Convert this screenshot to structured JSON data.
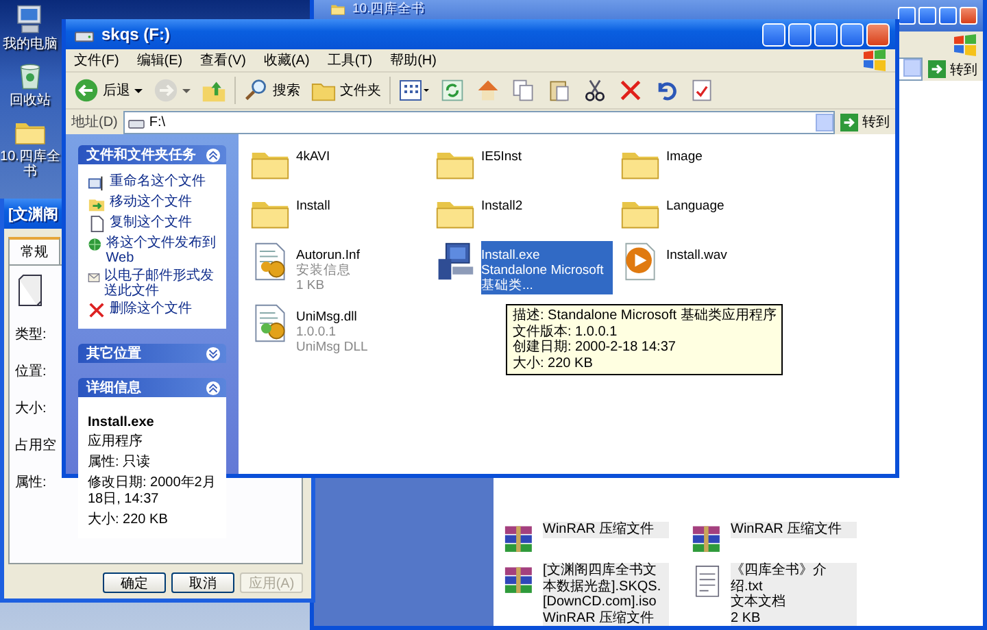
{
  "desktop": {
    "icons": [
      {
        "kind": "computer",
        "label": "我的电脑"
      },
      {
        "kind": "recycle",
        "label": "回收站"
      },
      {
        "kind": "folder",
        "label": "10.四库全书"
      }
    ]
  },
  "back_window": {
    "title": "10.四库全书",
    "go_button": "转到",
    "files": [
      {
        "kind": "rar",
        "lines": [
          "WinRAR 压缩文件"
        ]
      },
      {
        "kind": "rar",
        "lines": [
          "WinRAR 压缩文件"
        ]
      },
      {
        "kind": "rar",
        "lines": [
          "[文渊阁四库全书文本数据光盘].SKQS.[DownCD.com].iso",
          "WinRAR 压缩文件"
        ]
      },
      {
        "kind": "txt",
        "lines": [
          "《四库全书》介绍.txt",
          "文本文档",
          "2 KB"
        ]
      }
    ]
  },
  "properties_dialog": {
    "title": "[文渊阁",
    "tabs": [
      {
        "label": "常规",
        "selected": true
      }
    ],
    "fields": [
      "类型:",
      "位置:",
      "大小:",
      "占用空",
      "属性:"
    ],
    "buttons": [
      {
        "label": "确定",
        "disabled": false
      },
      {
        "label": "取消",
        "disabled": false
      },
      {
        "label": "应用(A)",
        "disabled": true
      }
    ]
  },
  "explorer": {
    "title": "skqs (F:)",
    "menu": [
      "文件(F)",
      "编辑(E)",
      "查看(V)",
      "收藏(A)",
      "工具(T)",
      "帮助(H)"
    ],
    "toolbar": [
      {
        "kind": "back",
        "label": "后退",
        "disabled": false
      },
      {
        "kind": "forward",
        "disabled": true
      },
      {
        "kind": "up",
        "disabled": false
      },
      {
        "kind": "search",
        "label": "搜索",
        "disabled": false
      },
      {
        "kind": "folders",
        "label": "文件夹",
        "disabled": false
      },
      {
        "kind": "views",
        "disabled": false
      },
      {
        "kind": "refresh",
        "disabled": false
      },
      {
        "kind": "home",
        "disabled": false
      },
      {
        "kind": "copy",
        "disabled": false
      },
      {
        "kind": "paste",
        "disabled": false
      },
      {
        "kind": "cut",
        "disabled": false
      },
      {
        "kind": "delete",
        "disabled": false
      },
      {
        "kind": "undo",
        "disabled": false
      },
      {
        "kind": "properties",
        "disabled": false
      }
    ],
    "address_label": "地址(D)",
    "address": "F:\\",
    "go_button": "转到",
    "panels": [
      {
        "title": "文件和文件夹任务",
        "expanded": true,
        "items": [
          {
            "kind": "rename",
            "label": "重命名这个文件"
          },
          {
            "kind": "move",
            "label": "移动这个文件"
          },
          {
            "kind": "copy",
            "label": "复制这个文件"
          },
          {
            "kind": "publish",
            "label": "将这个文件发布到 Web"
          },
          {
            "kind": "email",
            "label": "以电子邮件形式发送此文件"
          },
          {
            "kind": "delete",
            "label": "删除这个文件"
          }
        ]
      },
      {
        "title": "其它位置",
        "expanded": false
      },
      {
        "title": "详细信息",
        "expanded": true,
        "name": "Install.exe",
        "lines": [
          "应用程序",
          "属性: 只读",
          "修改日期: 2000年2月18日, 14:37",
          "大小: 220 KB"
        ]
      }
    ],
    "files": [
      {
        "kind": "folder",
        "lines": [
          "4kAVI"
        ],
        "selected": false
      },
      {
        "kind": "folder",
        "lines": [
          "IE5Inst"
        ],
        "selected": false
      },
      {
        "kind": "folder",
        "lines": [
          "Image"
        ],
        "selected": false
      },
      {
        "kind": "folder",
        "lines": [
          "Install"
        ],
        "selected": false
      },
      {
        "kind": "folder",
        "lines": [
          "Install2"
        ],
        "selected": false
      },
      {
        "kind": "folder",
        "lines": [
          "Language"
        ],
        "selected": false
      },
      {
        "kind": "inf",
        "lines": [
          "Autorun.Inf",
          "安装信息",
          "1 KB"
        ],
        "selected": false
      },
      {
        "kind": "exe",
        "lines": [
          "Install.exe",
          "Standalone Microsoft 基础类..."
        ],
        "selected": true
      },
      {
        "kind": "wav",
        "lines": [
          "Install.wav"
        ],
        "selected": false
      },
      {
        "kind": "dll",
        "lines": [
          "UniMsg.dll",
          "1.0.0.1",
          "UniMsg DLL"
        ],
        "selected": false
      }
    ],
    "tooltip": [
      "描述: Standalone Microsoft 基础类应用程序",
      "文件版本: 1.0.0.1",
      "创建日期: 2000-2-18 14:37",
      "大小: 220 KB"
    ]
  }
}
